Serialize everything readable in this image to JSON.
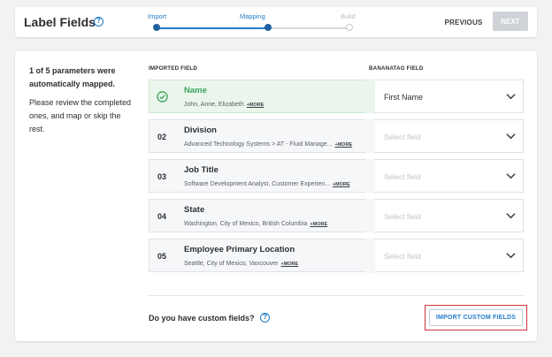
{
  "header": {
    "title": "Label Fields",
    "help_icon": "?",
    "steps": [
      {
        "label": "Import",
        "state": "done"
      },
      {
        "label": "Mapping",
        "state": "current"
      },
      {
        "label": "Build",
        "state": "pending"
      }
    ],
    "previous_label": "PREVIOUS",
    "next_label": "NEXT"
  },
  "intro": {
    "bold_text": "1 of 5 parameters were automatically mapped.",
    "body_text": "Please review the completed ones, and map or skip the rest."
  },
  "columns": {
    "imported": "IMPORTED FIELD",
    "bananatag": "BANANATAG FIELD"
  },
  "rows": [
    {
      "num": "",
      "name": "Name",
      "sample": "John, Anne, Elizabeth",
      "more": "+MORE",
      "value": "First Name",
      "matched": true
    },
    {
      "num": "02",
      "name": "Division",
      "sample": "Advanced Technology Systems > AT - Fluid Manage...",
      "more": "+MORE",
      "value": "Select field",
      "matched": false
    },
    {
      "num": "03",
      "name": "Job Title",
      "sample": "Software Development Analyst, Customer Experien...",
      "more": "+MORE",
      "value": "Select field",
      "matched": false
    },
    {
      "num": "04",
      "name": "State",
      "sample": "Washington, City of Mexico, British Columbia",
      "more": "+MORE",
      "value": "Select field",
      "matched": false
    },
    {
      "num": "05",
      "name": "Employee Primary Location",
      "sample": "Seattle, City of Mexico, Vancouver",
      "more": "+MORE",
      "value": "Select field",
      "matched": false
    }
  ],
  "custom": {
    "question": "Do you have custom fields?",
    "button_label": "IMPORT CUSTOM FIELDS"
  },
  "colors": {
    "accent": "#1f7bc9",
    "success": "#3aa35a",
    "highlight": "#d2313c",
    "disabled": "#cfd2d6"
  },
  "icons": [
    "help-icon",
    "check-circle-icon",
    "chevron-down-icon"
  ]
}
